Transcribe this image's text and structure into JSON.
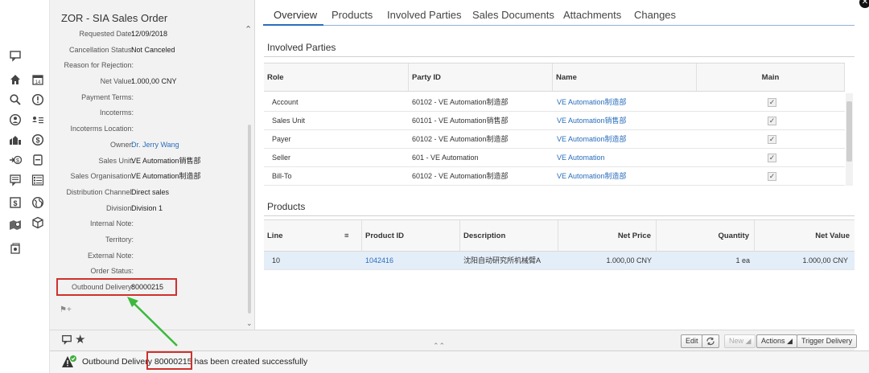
{
  "left_panel": {
    "title": "ZOR - SIA Sales Order",
    "fields": [
      {
        "label": "Requested Date:",
        "value": "12/09/2018",
        "link": false
      },
      {
        "label": "Cancellation Status:",
        "value": "Not Canceled",
        "link": false
      },
      {
        "label": "Reason for Rejection:",
        "value": "",
        "link": false
      },
      {
        "label": "Net Value:",
        "value": "1.000,00 CNY",
        "link": false
      },
      {
        "label": "Payment Terms:",
        "value": "",
        "link": false
      },
      {
        "label": "Incoterms:",
        "value": "",
        "link": false
      },
      {
        "label": "Incoterms Location:",
        "value": "",
        "link": false
      },
      {
        "label": "Owner:",
        "value": "Dr. Jerry Wang",
        "link": true
      },
      {
        "label": "Sales Unit:",
        "value": "VE Automation销售部",
        "link": false
      },
      {
        "label": "Sales Organisation:",
        "value": "VE Automation制造部",
        "link": false
      },
      {
        "label": "Distribution Channel:",
        "value": "Direct sales",
        "link": false
      },
      {
        "label": "Division:",
        "value": "Division 1",
        "link": false
      },
      {
        "label": "Internal Note:",
        "value": "",
        "link": false
      },
      {
        "label": "Territory:",
        "value": "",
        "link": false
      },
      {
        "label": "External Note:",
        "value": "",
        "link": false
      },
      {
        "label": "Order Status:",
        "value": "",
        "link": false
      },
      {
        "label": "Outbound Delivery:",
        "value": "80000215",
        "link": false
      }
    ]
  },
  "tabs": [
    "Overview",
    "Products",
    "Involved Parties",
    "Sales Documents",
    "Attachments",
    "Changes"
  ],
  "involved_parties": {
    "title": "Involved Parties",
    "columns": [
      "Role",
      "Party ID",
      "Name",
      "Main"
    ],
    "rows": [
      {
        "role": "Account",
        "party_id": "60102 - VE Automation制造部",
        "name": "VE Automation制造部",
        "main": true
      },
      {
        "role": "Sales Unit",
        "party_id": "60101 - VE Automation销售部",
        "name": "VE Automation销售部",
        "main": true
      },
      {
        "role": "Payer",
        "party_id": "60102 - VE Automation制造部",
        "name": "VE Automation制造部",
        "main": true
      },
      {
        "role": "Seller",
        "party_id": "601 - VE Automation",
        "name": "VE Automation",
        "main": true
      },
      {
        "role": "Bill-To",
        "party_id": "60102 - VE Automation制造部",
        "name": "VE Automation制造部",
        "main": true
      }
    ]
  },
  "products": {
    "title": "Products",
    "columns": [
      "Line",
      "Product ID",
      "Description",
      "Net Price",
      "Quantity",
      "Net Value"
    ],
    "rows": [
      {
        "line": "10",
        "product_id": "1042416",
        "description": "沈阳自动研究所机械臂A",
        "net_price": "1.000,00  CNY",
        "quantity": "1  ea",
        "net_value": "1.000,00  CNY"
      }
    ]
  },
  "buttons": {
    "edit": "Edit",
    "new": "New",
    "actions": "Actions",
    "trigger": "Trigger Delivery"
  },
  "message": {
    "prefix": "Outbound Delivery ",
    "number": "80000215",
    "suffix": " has been created successfully"
  },
  "colors": {
    "accent": "#2a6ebb",
    "highlight": "#d0312d",
    "arrow": "#3cb93c"
  }
}
